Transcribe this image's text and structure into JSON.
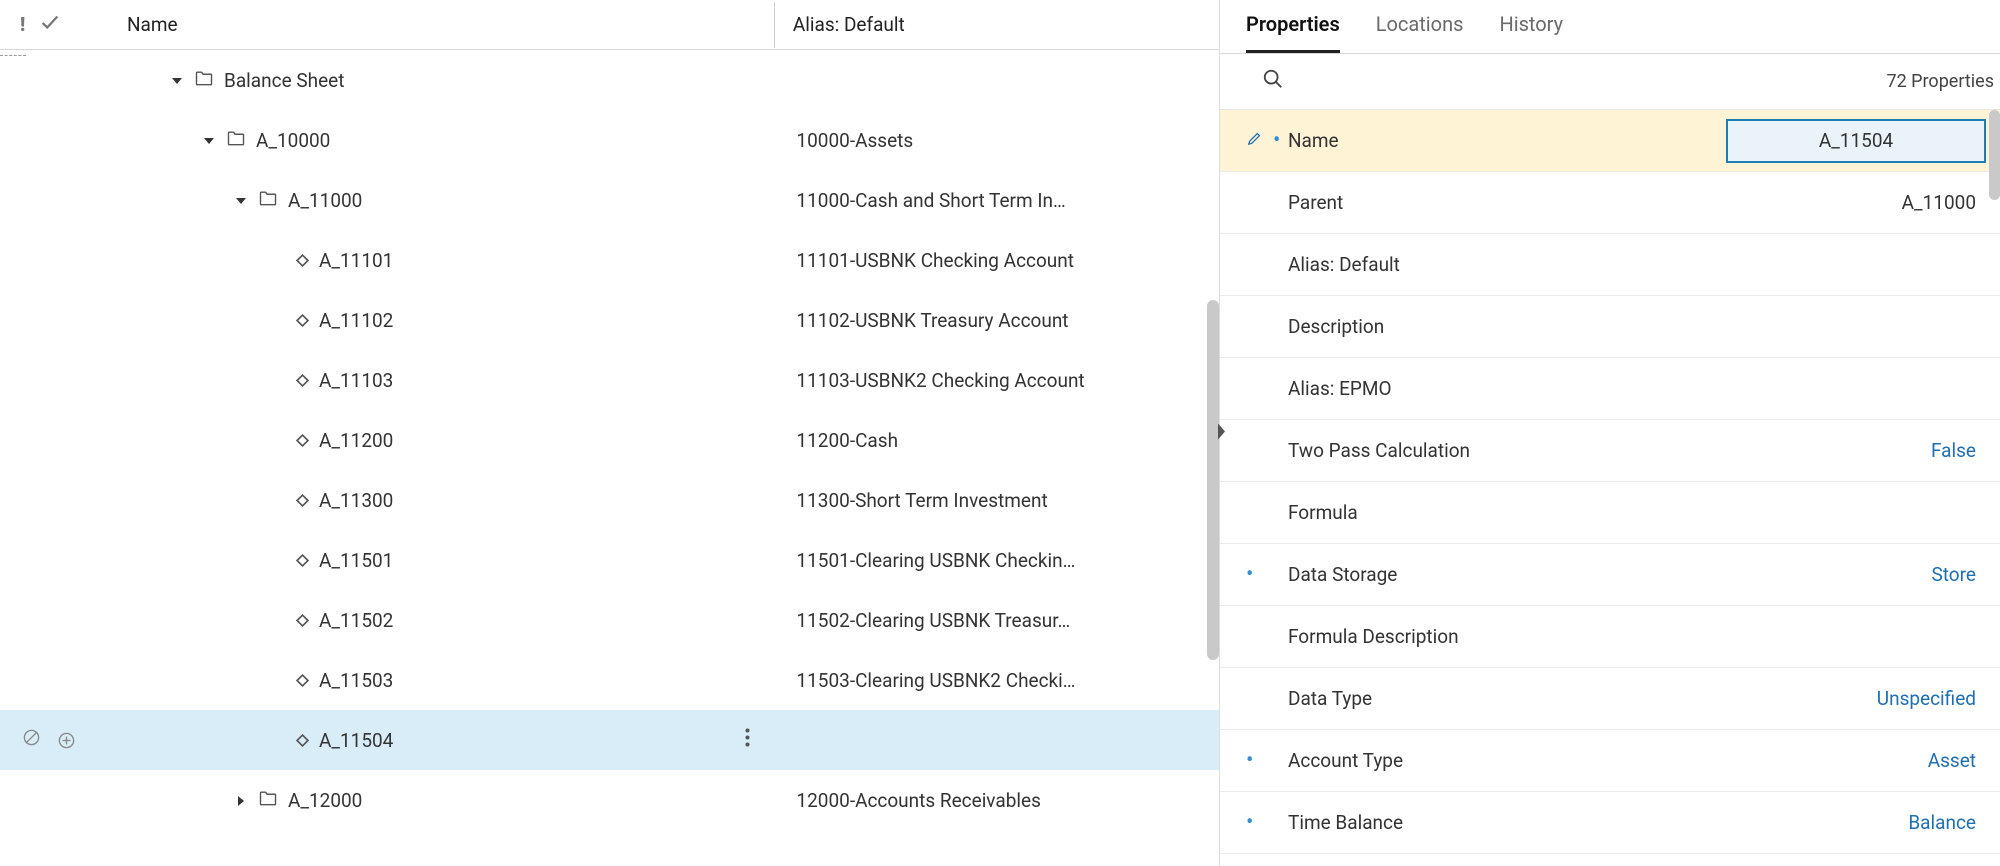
{
  "header": {
    "name_col": "Name",
    "alias_col": "Alias: Default"
  },
  "tree": {
    "rows": [
      {
        "indent": 150,
        "toggle": "down",
        "icon": "folder",
        "name": "Balance Sheet",
        "alias": ""
      },
      {
        "indent": 182,
        "toggle": "down",
        "icon": "folder",
        "name": "A_10000",
        "alias": "10000-Assets"
      },
      {
        "indent": 214,
        "toggle": "down",
        "icon": "folder",
        "name": "A_11000",
        "alias": "11000-Cash and Short Term In…"
      },
      {
        "indent": 252,
        "toggle": "",
        "icon": "leaf",
        "name": "A_11101",
        "alias": "11101-USBNK Checking Account"
      },
      {
        "indent": 252,
        "toggle": "",
        "icon": "leaf",
        "name": "A_11102",
        "alias": "11102-USBNK Treasury Account"
      },
      {
        "indent": 252,
        "toggle": "",
        "icon": "leaf",
        "name": "A_11103",
        "alias": "11103-USBNK2 Checking Account"
      },
      {
        "indent": 252,
        "toggle": "",
        "icon": "leaf",
        "name": "A_11200",
        "alias": "11200-Cash"
      },
      {
        "indent": 252,
        "toggle": "",
        "icon": "leaf",
        "name": "A_11300",
        "alias": "11300-Short Term Investment"
      },
      {
        "indent": 252,
        "toggle": "",
        "icon": "leaf",
        "name": "A_11501",
        "alias": "11501-Clearing USBNK Checkin…"
      },
      {
        "indent": 252,
        "toggle": "",
        "icon": "leaf",
        "name": "A_11502",
        "alias": "11502-Clearing USBNK Treasur…"
      },
      {
        "indent": 252,
        "toggle": "",
        "icon": "leaf",
        "name": "A_11503",
        "alias": "11503-Clearing USBNK2 Checki…"
      },
      {
        "indent": 252,
        "toggle": "",
        "icon": "leaf",
        "name": "A_11504",
        "alias": "",
        "selected": true,
        "gutter": true,
        "kebab": true
      },
      {
        "indent": 214,
        "toggle": "right",
        "icon": "folder",
        "name": "A_12000",
        "alias": "12000-Accounts Receivables"
      }
    ]
  },
  "tabs": {
    "t0": "Properties",
    "t1": "Locations",
    "t2": "History"
  },
  "props": {
    "count": "72 Properties",
    "rows": [
      {
        "label": "Name",
        "value": "A_11504",
        "editing": true,
        "dot": true,
        "pencil": true
      },
      {
        "label": "Parent",
        "value": "A_11000"
      },
      {
        "label": "Alias: Default",
        "value": ""
      },
      {
        "label": "Description",
        "value": ""
      },
      {
        "label": "Alias: EPMO",
        "value": ""
      },
      {
        "label": "Two Pass Calculation",
        "value": "False",
        "link": true
      },
      {
        "label": "Formula",
        "value": ""
      },
      {
        "label": "Data Storage",
        "value": "Store",
        "link": true,
        "dot": true
      },
      {
        "label": "Formula Description",
        "value": ""
      },
      {
        "label": "Data Type",
        "value": "Unspecified",
        "link": true
      },
      {
        "label": "Account Type",
        "value": "Asset",
        "link": true,
        "dot": true
      },
      {
        "label": "Time Balance",
        "value": "Balance",
        "link": true,
        "dot": true
      }
    ]
  }
}
